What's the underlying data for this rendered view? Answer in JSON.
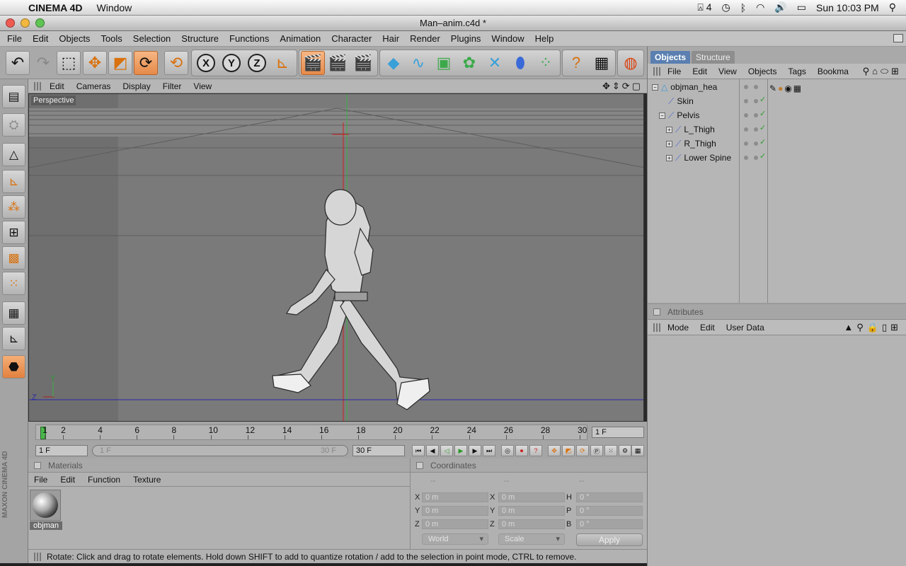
{
  "mac_menubar": {
    "app_name": "CINEMA 4D",
    "items": [
      "Window"
    ],
    "status": {
      "adobe_badge": "4",
      "clock": "Sun 10:03 PM"
    }
  },
  "window": {
    "title": "Man–anim.c4d *"
  },
  "app_menu": [
    "File",
    "Edit",
    "Objects",
    "Tools",
    "Selection",
    "Structure",
    "Functions",
    "Animation",
    "Character",
    "Hair",
    "Render",
    "Plugins",
    "Window",
    "Help"
  ],
  "toolbar": {
    "axis_x": "X",
    "axis_y": "Y",
    "axis_z": "Z"
  },
  "viewport": {
    "menu": [
      "Edit",
      "Cameras",
      "Display",
      "Filter",
      "View"
    ],
    "label": "Perspective",
    "axis_y_label": "Y",
    "axis_z_label": "Z"
  },
  "objects_panel": {
    "tabs": [
      "Objects",
      "Structure"
    ],
    "menu": [
      "File",
      "Edit",
      "View",
      "Objects",
      "Tags",
      "Bookma"
    ],
    "items": [
      {
        "name": "objman_hea"
      },
      {
        "name": "Skin"
      },
      {
        "name": "Pelvis"
      },
      {
        "name": "L_Thigh"
      },
      {
        "name": "R_Thigh"
      },
      {
        "name": "Lower Spine"
      }
    ]
  },
  "attributes_panel": {
    "title": "Attributes",
    "menu": [
      "Mode",
      "Edit",
      "User Data"
    ]
  },
  "timeline": {
    "ticks": [
      "1",
      "2",
      "4",
      "6",
      "8",
      "10",
      "12",
      "14",
      "16",
      "18",
      "20",
      "22",
      "24",
      "26",
      "28",
      "30"
    ],
    "current_frame": "1 F",
    "start_frame": "1 F",
    "range_start": "1 F",
    "range_end": "30 F",
    "end_frame": "30 F",
    "playhead_fraction": 0.0
  },
  "materials_panel": {
    "title": "Materials",
    "menu": [
      "File",
      "Edit",
      "Function",
      "Texture"
    ],
    "material_name": "objman"
  },
  "coordinates_panel": {
    "title": "Coordinates",
    "col_headers": [
      "--",
      "--",
      "--"
    ],
    "rows": [
      {
        "l1": "X",
        "v1": "0 m",
        "l2": "X",
        "v2": "0 m",
        "l3": "H",
        "v3": "0 °"
      },
      {
        "l1": "Y",
        "v1": "0 m",
        "l2": "Y",
        "v2": "0 m",
        "l3": "P",
        "v3": "0 °"
      },
      {
        "l1": "Z",
        "v1": "0 m",
        "l2": "Z",
        "v2": "0 m",
        "l3": "B",
        "v3": "0 °"
      }
    ],
    "space": "World",
    "mode": "Scale",
    "apply": "Apply"
  },
  "status_text": "Rotate: Click and drag to rotate elements. Hold down SHIFT to add to quantize rotation / add to the selection in point mode, CTRL to remove.",
  "branding": "MAXON CINEMA 4D"
}
